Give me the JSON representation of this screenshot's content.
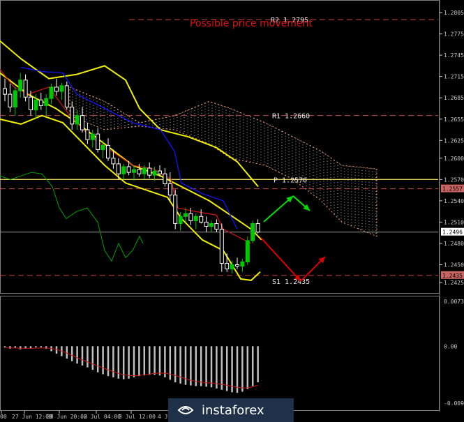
{
  "annotation": "Possible price movement",
  "levels": [
    {
      "label": "R2",
      "value": "1.2795"
    },
    {
      "label": "R1",
      "value": "1.2660"
    },
    {
      "label": "P",
      "value": "1.2570"
    },
    {
      "label": "S1",
      "value": "1.2435"
    }
  ],
  "price_axis": [
    "1.2805",
    "1.2775",
    "1.2745",
    "1.2715",
    "1.2685",
    "1.2655",
    "1.2625",
    "1.2600",
    "1.2570",
    "1.2540",
    "1.2510",
    "1.2480",
    "1.2450",
    "1.2425"
  ],
  "price_markers": [
    {
      "value": "1.2557",
      "bg": "#c86464"
    },
    {
      "value": "1.2496",
      "bg": "#ffffff"
    },
    {
      "value": "1.2435",
      "bg": "#c86464"
    }
  ],
  "osc_axis": [
    "0.00732",
    "0.00",
    "-0.00926"
  ],
  "time_axis": [
    "00",
    "27 Jun 12:00",
    "28 Jun 20:00",
    "2 Jul 04:00",
    "3 Jul 12:00",
    "4 Jul 2"
  ],
  "brand": "instaforex",
  "colors": {
    "bull": "#00c800",
    "bear": "#ffffff",
    "bands": "#f0f000",
    "tenkan": "#c81414",
    "kijun": "#1414ff",
    "chikou": "#00a000",
    "cloud": "#ff9966",
    "cloud_dots": "#ffffff",
    "osc_hist": "#c0c0c0",
    "osc_signal": "#c81414",
    "arrow_up": "#00dd00",
    "arrow_down": "#dd0000",
    "level_line": "#c84646",
    "pivot_line": "#e8d060"
  },
  "chart_data": {
    "type": "candlestick",
    "symbol_quote_axis": [
      1.2425,
      1.2805
    ],
    "oscillator_range": [
      -0.00926,
      0.00732
    ],
    "pivot_levels": {
      "R2": 1.2795,
      "R1": 1.266,
      "P": 1.257,
      "S1": 1.2435
    },
    "current_price": 1.2496,
    "marked_prices": [
      1.2557,
      1.2496,
      1.2435
    ],
    "candles": [
      [
        1.2698,
        1.2712,
        1.268,
        1.269
      ],
      [
        1.269,
        1.2705,
        1.2665,
        1.2672
      ],
      [
        1.2672,
        1.27,
        1.266,
        1.2695
      ],
      [
        1.2695,
        1.272,
        1.2685,
        1.271
      ],
      [
        1.271,
        1.2718,
        1.268,
        1.2686
      ],
      [
        1.2686,
        1.2695,
        1.266,
        1.2668
      ],
      [
        1.2668,
        1.269,
        1.2655,
        1.2682
      ],
      [
        1.2682,
        1.2692,
        1.2668,
        1.2674
      ],
      [
        1.2674,
        1.269,
        1.266,
        1.2684
      ],
      [
        1.2684,
        1.2705,
        1.2676,
        1.27
      ],
      [
        1.27,
        1.2712,
        1.2688,
        1.2694
      ],
      [
        1.2694,
        1.2706,
        1.2682,
        1.2702
      ],
      [
        1.2702,
        1.2708,
        1.2668,
        1.2672
      ],
      [
        1.2672,
        1.268,
        1.264,
        1.2648
      ],
      [
        1.2648,
        1.2668,
        1.264,
        1.266
      ],
      [
        1.266,
        1.2672,
        1.2636,
        1.264
      ],
      [
        1.264,
        1.265,
        1.262,
        1.2626
      ],
      [
        1.2626,
        1.264,
        1.2615,
        1.2634
      ],
      [
        1.2634,
        1.2642,
        1.2608,
        1.2612
      ],
      [
        1.2612,
        1.2625,
        1.26,
        1.2618
      ],
      [
        1.2618,
        1.2628,
        1.2596,
        1.26
      ],
      [
        1.26,
        1.2612,
        1.2585,
        1.2592
      ],
      [
        1.2592,
        1.26,
        1.257,
        1.2578
      ],
      [
        1.2578,
        1.2592,
        1.257,
        1.2588
      ],
      [
        1.2588,
        1.2596,
        1.2576,
        1.258
      ],
      [
        1.258,
        1.259,
        1.2568,
        1.2584
      ],
      [
        1.2584,
        1.2592,
        1.2574,
        1.2578
      ],
      [
        1.2578,
        1.259,
        1.257,
        1.2586
      ],
      [
        1.2586,
        1.2594,
        1.2572,
        1.2576
      ],
      [
        1.2576,
        1.2588,
        1.2568,
        1.2582
      ],
      [
        1.2582,
        1.259,
        1.2574,
        1.2578
      ],
      [
        1.2578,
        1.2586,
        1.256,
        1.2564
      ],
      [
        1.2564,
        1.258,
        1.254,
        1.2548
      ],
      [
        1.2548,
        1.2556,
        1.25,
        1.2508
      ],
      [
        1.2508,
        1.2524,
        1.2498,
        1.2518
      ],
      [
        1.2518,
        1.253,
        1.251,
        1.2522
      ],
      [
        1.2522,
        1.253,
        1.2506,
        1.2512
      ],
      [
        1.2512,
        1.2522,
        1.25,
        1.2518
      ],
      [
        1.2518,
        1.2528,
        1.2508,
        1.251
      ],
      [
        1.251,
        1.2518,
        1.2496,
        1.2504
      ],
      [
        1.2504,
        1.2512,
        1.2496,
        1.2508
      ],
      [
        1.2508,
        1.2514,
        1.2496,
        1.25
      ],
      [
        1.25,
        1.2508,
        1.244,
        1.2452
      ],
      [
        1.2452,
        1.2466,
        1.244,
        1.2444
      ],
      [
        1.2444,
        1.2456,
        1.2438,
        1.245
      ],
      [
        1.245,
        1.246,
        1.2444,
        1.2448
      ],
      [
        1.2448,
        1.2458,
        1.244,
        1.2454
      ],
      [
        1.2454,
        1.249,
        1.245,
        1.2484
      ],
      [
        1.2484,
        1.2512,
        1.248,
        1.2508
      ],
      [
        1.2508,
        1.2514,
        1.2494,
        1.2496
      ]
    ],
    "oscillator_values": [
      -0.0002,
      -0.0004,
      -0.0003,
      -0.0005,
      -0.0004,
      -0.0003,
      -0.0002,
      -0.0002,
      -0.0004,
      -0.0008,
      -0.0012,
      -0.0016,
      -0.002,
      -0.0024,
      -0.0028,
      -0.0031,
      -0.0034,
      -0.0038,
      -0.0042,
      -0.0045,
      -0.0048,
      -0.005,
      -0.0052,
      -0.0053,
      -0.0052,
      -0.005,
      -0.0048,
      -0.0047,
      -0.0046,
      -0.0046,
      -0.0047,
      -0.005,
      -0.0054,
      -0.0058,
      -0.006,
      -0.0062,
      -0.0063,
      -0.0064,
      -0.0064,
      -0.0065,
      -0.0066,
      -0.0068,
      -0.007,
      -0.0072,
      -0.0074,
      -0.0075,
      -0.0073,
      -0.0069,
      -0.0064,
      -0.0058
    ]
  }
}
